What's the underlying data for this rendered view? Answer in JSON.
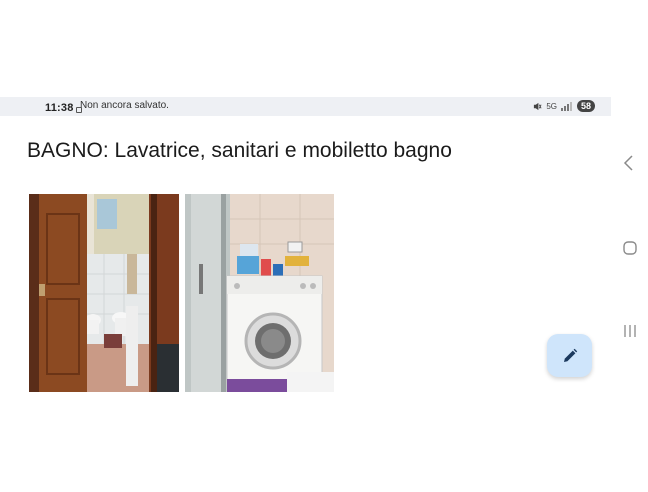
{
  "status_bar": {
    "time": "11:38",
    "notice": "Non ancora salvato.",
    "battery": "58",
    "signal_label": "5G"
  },
  "note": {
    "title": "BAGNO: Lavatrice, sanitari e mobiletto bagno"
  },
  "images": [
    {
      "icon": "photo-bathroom-doorway"
    },
    {
      "icon": "photo-washing-machine"
    }
  ],
  "fab": {
    "icon": "pencil-icon"
  },
  "nav": {
    "back_icon": "chevron-left-icon",
    "home_icon": "circle-home-icon",
    "recents_icon": "recents-bars-icon"
  },
  "colors": {
    "fab_bg": "#cfe5fb",
    "status_bg": "#eef0f4",
    "text": "#1b1b1b"
  }
}
